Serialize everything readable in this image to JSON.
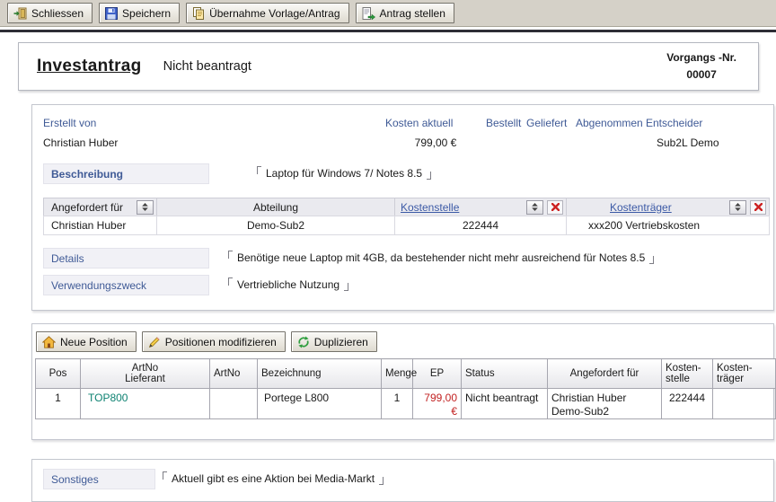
{
  "colors": {
    "label_blue": "#3f5a96",
    "link_blue": "#3c5aa6",
    "price_red": "#c22222",
    "artno_teal": "#0e8272",
    "delete_red": "#cc2222",
    "toolbar_bg": "#d5d1c8"
  },
  "toolbar": {
    "buttons": [
      {
        "label": "Schliessen",
        "icon": "exit-door-icon"
      },
      {
        "label": "Speichern",
        "icon": "save-disk-icon"
      },
      {
        "label": "Übernahme Vorlage/Antrag",
        "icon": "copy-documents-icon"
      },
      {
        "label": "Antrag stellen",
        "icon": "submit-document-icon"
      }
    ]
  },
  "header": {
    "title": "Investantrag",
    "status": "Nicht beantragt",
    "process_no_label": "Vorgangs -Nr.",
    "process_no_value": "00007"
  },
  "info": {
    "erstellt_von": {
      "label": "Erstellt von",
      "value": "Christian Huber"
    },
    "kosten_aktuell": {
      "label": "Kosten aktuell",
      "value": "799,00 €"
    },
    "bestellt": {
      "label": "Bestellt",
      "value": ""
    },
    "geliefert": {
      "label": "Geliefert",
      "value": ""
    },
    "abgenommen": {
      "label": "Abgenommen",
      "value": ""
    },
    "entscheider": {
      "label": "Entscheider",
      "value": "Sub2L Demo"
    }
  },
  "beschreibung": {
    "label": "Beschreibung",
    "value": "Laptop für Windows 7/ Notes 8.5"
  },
  "zuordnung": {
    "headers": [
      "Angefordert für",
      "Abteilung",
      "Kostenstelle",
      "Kostenträger"
    ],
    "row": [
      "Christian Huber",
      "Demo-Sub2",
      "222444",
      "xxx200 Vertriebskosten"
    ]
  },
  "details": {
    "label": "Details",
    "value": "Benötige neue Laptop mit 4GB, da bestehender nicht mehr ausreichend für Notes 8.5"
  },
  "verwendungszweck": {
    "label": "Verwendungszweck",
    "value": "Vertriebliche Nutzung"
  },
  "positions": {
    "buttons": [
      {
        "label": "Neue Position",
        "icon": "house-icon"
      },
      {
        "label": "Positionen modifizieren",
        "icon": "pencil-icon"
      },
      {
        "label": "Duplizieren",
        "icon": "recycle-icon"
      }
    ],
    "table": {
      "headers": [
        "Pos",
        "ArtNo\nLieferant",
        "ArtNo",
        "Bezeichnung",
        "Menge",
        "EP",
        "Status",
        "Angefordert für",
        "Kosten-\nstelle",
        "Kosten-\nträger"
      ],
      "rows": [
        {
          "cells": [
            "1",
            "TOP800",
            "",
            "Portege L800",
            "1",
            "799,00 €",
            "Nicht beantragt",
            "Christian Huber\nDemo-Sub2",
            "222444",
            ""
          ]
        }
      ]
    }
  },
  "sonstiges": {
    "label": "Sonstiges",
    "value": "Aktuell gibt es eine Aktion bei Media-Markt"
  }
}
